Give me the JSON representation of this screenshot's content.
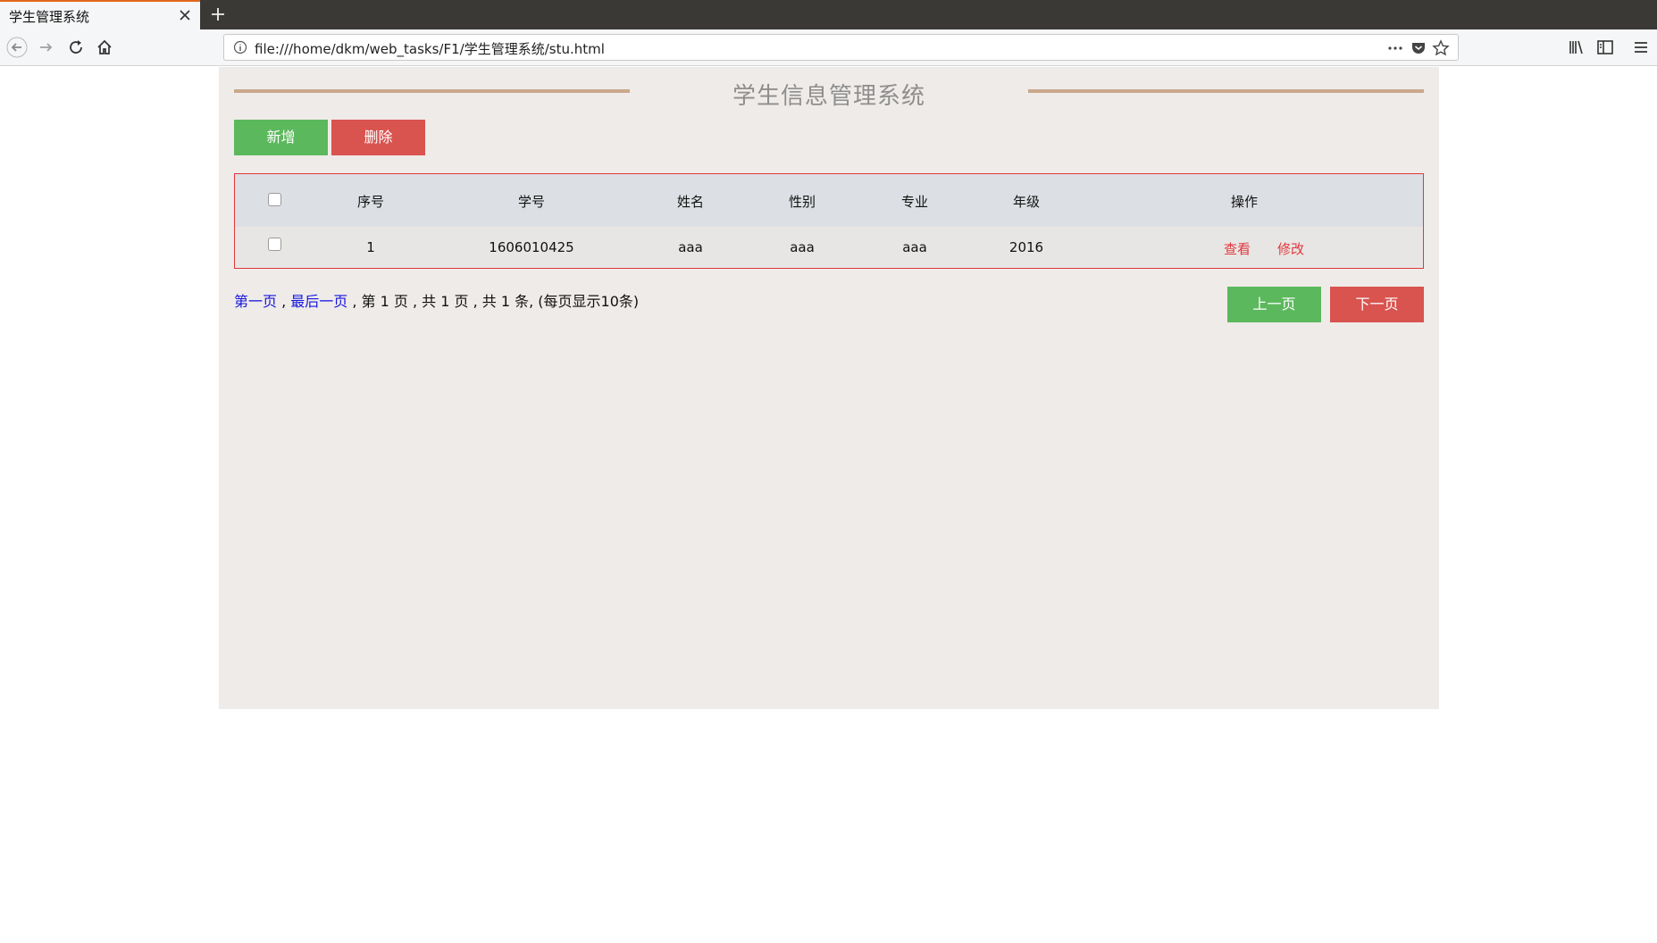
{
  "browser": {
    "tab_title": "学生管理系统",
    "url": "file:///home/dkm/web_tasks/F1/学生管理系统/stu.html"
  },
  "page": {
    "title": "学生信息管理系统",
    "buttons": {
      "add": "新增",
      "delete": "删除",
      "prev": "上一页",
      "next": "下一页"
    },
    "table": {
      "headers": [
        "序号",
        "学号",
        "姓名",
        "性别",
        "专业",
        "年级",
        "操作"
      ],
      "rows": [
        {
          "index": "1",
          "student_id": "1606010425",
          "name": "aaa",
          "gender": "aaa",
          "major": "aaa",
          "grade": "2016",
          "actions": [
            "查看",
            "修改"
          ]
        }
      ]
    },
    "pagination": {
      "first": "第一页",
      "sep1": " , ",
      "last": "最后一页",
      "info": " , 第 1 页 , 共 1 页 , 共 1 条, (每页显示10条)"
    }
  },
  "colors": {
    "page_bg": "#efebe8",
    "green": "#5cb85c",
    "red": "#d9534f",
    "table_border": "#e0383e",
    "link_blue": "#1515e0"
  }
}
